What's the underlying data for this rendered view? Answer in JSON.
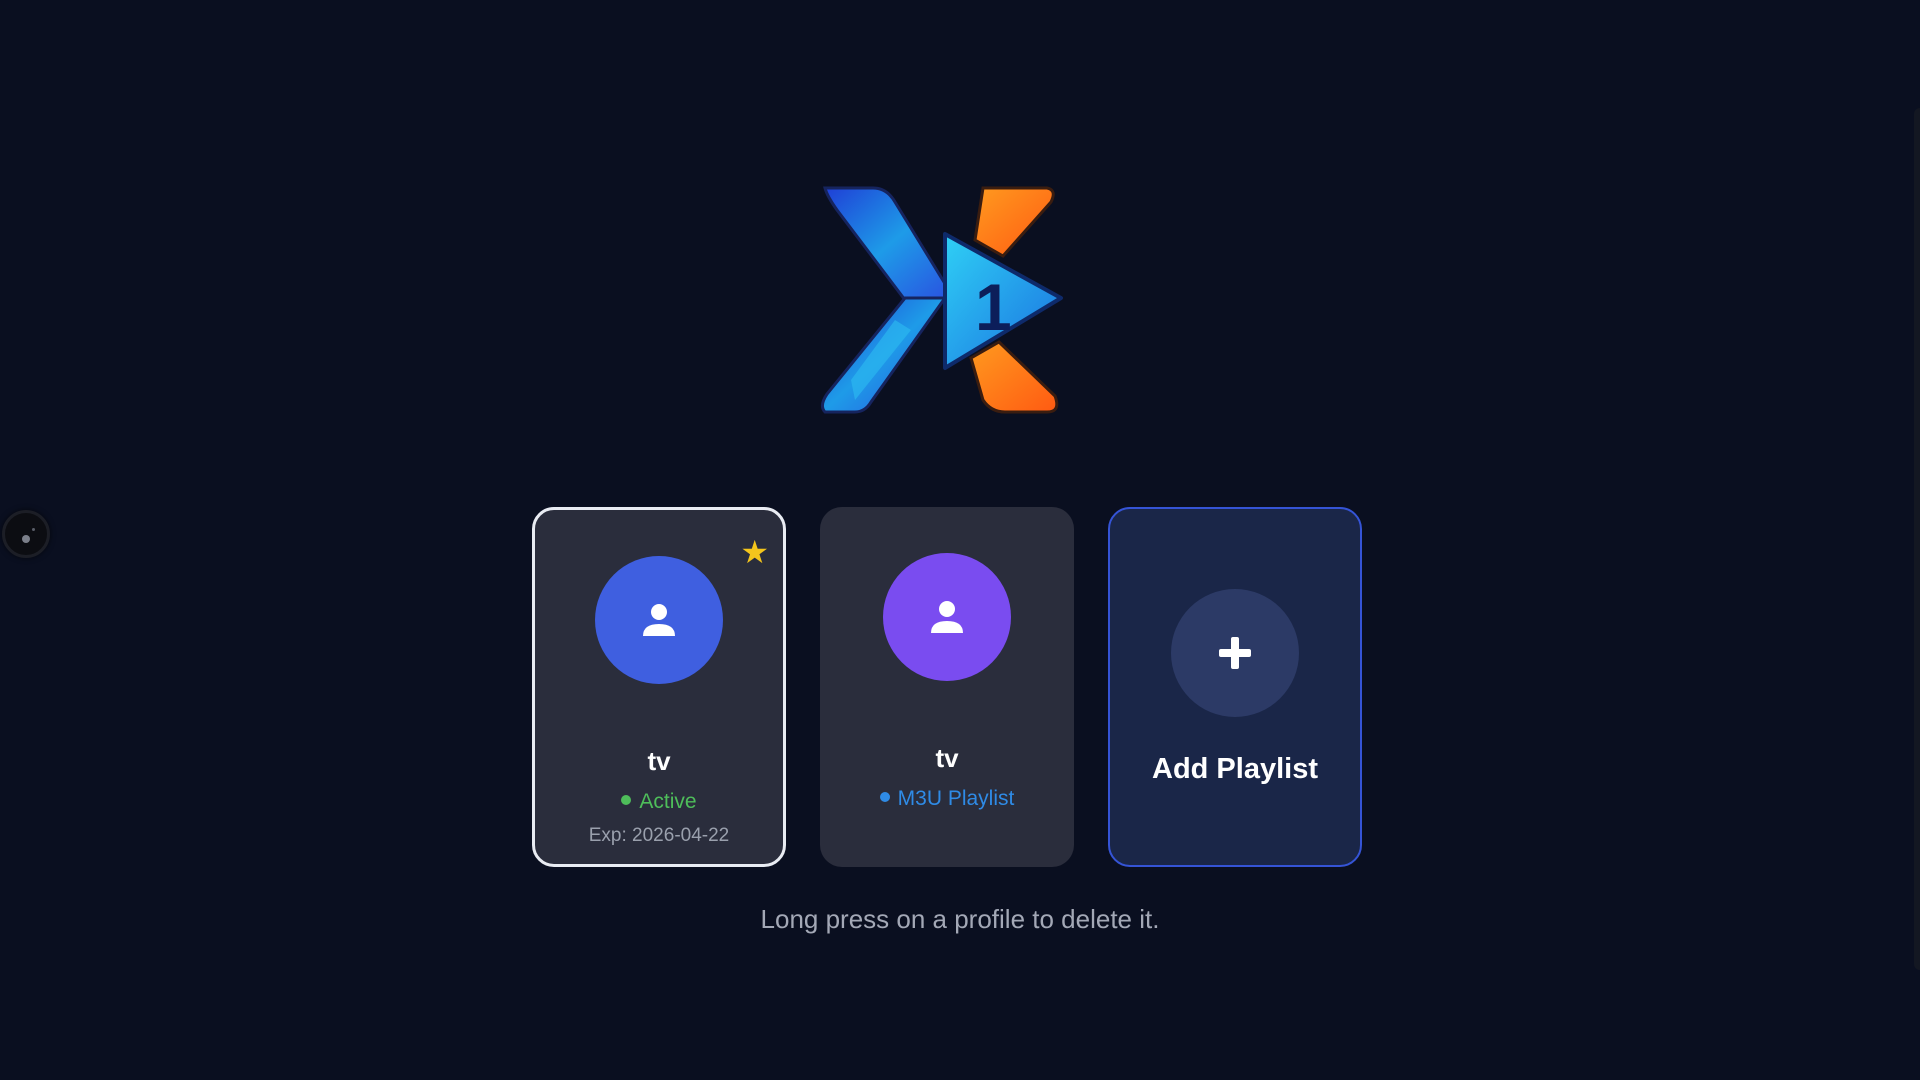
{
  "colors": {
    "background": "#0a0f20",
    "card_background": "#2a2d3c",
    "add_card_background": "#1a2648",
    "add_card_border": "#3554d6",
    "avatar_blue": "#3f5fe0",
    "avatar_purple": "#7a4cf0",
    "active_green": "#4ebd5a",
    "m3u_blue": "#2f8be6",
    "star_yellow": "#f4c51c"
  },
  "logo": {
    "icon": "x1-play-logo-icon",
    "number": "1"
  },
  "profiles": [
    {
      "name": "tv",
      "avatar_icon": "person-icon",
      "avatar_color": "#3f5fe0",
      "favorite": true,
      "favorite_icon": "star-icon",
      "star": "★",
      "status": "Active",
      "status_color": "#4ebd5a",
      "expiry": "Exp: 2026-04-22",
      "selected": true
    },
    {
      "name": "tv",
      "avatar_icon": "person-icon",
      "avatar_color": "#7a4cf0",
      "favorite": false,
      "status": "M3U Playlist",
      "status_color": "#2f8be6",
      "selected": false
    }
  ],
  "add_playlist": {
    "icon": "plus-icon",
    "label": "Add Playlist"
  },
  "hint": "Long press on a profile to delete it."
}
